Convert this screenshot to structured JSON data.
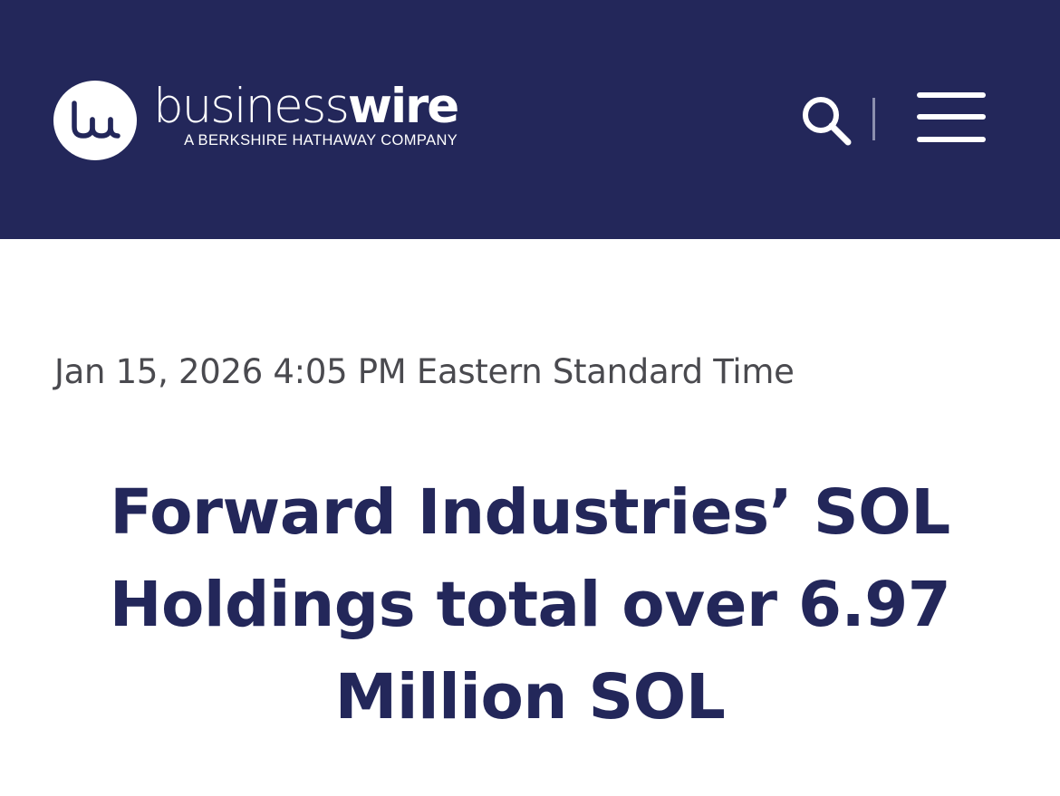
{
  "header": {
    "logo_icon": "bw-monogram-icon",
    "brand_light": "business",
    "brand_bold": "wire",
    "tagline": "A BERKSHIRE HATHAWAY COMPANY",
    "search_icon": "search-icon",
    "menu_icon": "hamburger-menu-icon",
    "background_color": "#23275a"
  },
  "article": {
    "timestamp": "Jan 15, 2026 4:05 PM Eastern Standard Time",
    "headline": "Forward Industries’ SOL Holdings total over 6.97 Million SOL",
    "headline_color": "#23275a",
    "timestamp_color": "#4a4a4f"
  }
}
